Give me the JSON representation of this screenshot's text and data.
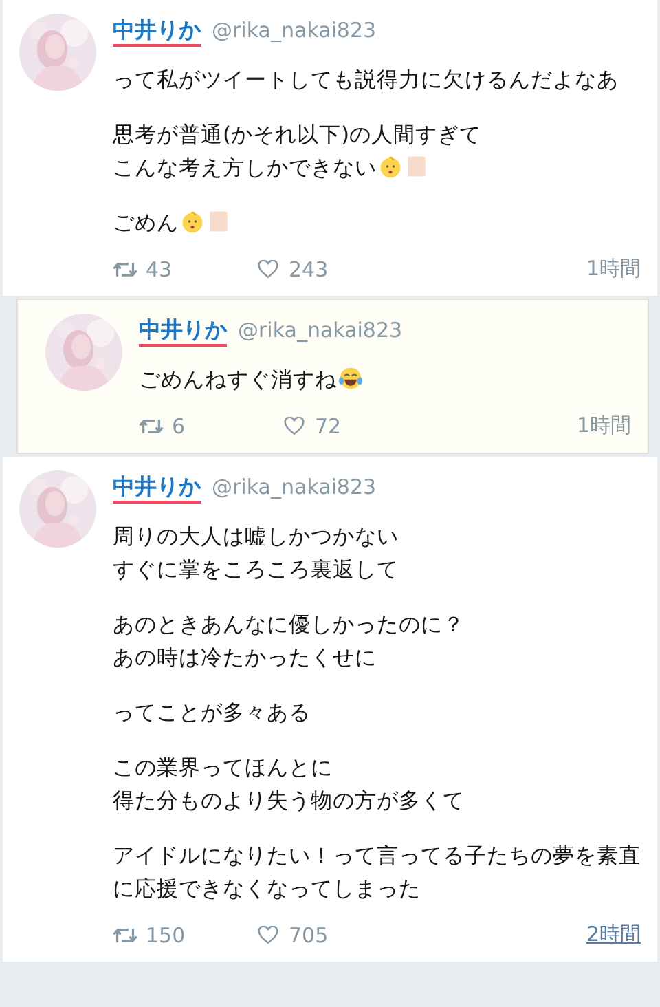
{
  "tweets": [
    {
      "highlighted": false,
      "name": "中井りか",
      "handle": "@rika_nakai823",
      "paragraphs": [
        {
          "lines": [
            {
              "kind": "plain",
              "text": "って私がツイートしても説得力に欠けるんだよなあ"
            }
          ]
        },
        {
          "lines": [
            {
              "kind": "plain",
              "text": "思考が普通(かそれ以下)の人間すぎて"
            },
            {
              "kind": "baby",
              "text": "こんな考え方しかできない"
            }
          ]
        },
        {
          "lines": [
            {
              "kind": "baby",
              "text": "ごめん"
            }
          ]
        }
      ],
      "retweets": "43",
      "likes": "243",
      "time": "1時間",
      "time_underlined": false
    },
    {
      "highlighted": true,
      "name": "中井りか",
      "handle": "@rika_nakai823",
      "paragraphs": [
        {
          "lines": [
            {
              "kind": "laugh",
              "text": "ごめんねすぐ消すね"
            }
          ]
        }
      ],
      "retweets": "6",
      "likes": "72",
      "time": "1時間",
      "time_underlined": false
    },
    {
      "highlighted": false,
      "name": "中井りか",
      "handle": "@rika_nakai823",
      "paragraphs": [
        {
          "lines": [
            {
              "kind": "plain",
              "text": "周りの大人は嘘しかつかない"
            },
            {
              "kind": "plain",
              "text": "すぐに掌をころころ裏返して"
            }
          ]
        },
        {
          "lines": [
            {
              "kind": "plain",
              "text": "あのときあんなに優しかったのに？"
            },
            {
              "kind": "plain",
              "text": "あの時は冷たかったくせに"
            }
          ]
        },
        {
          "lines": [
            {
              "kind": "plain",
              "text": "ってことが多々ある"
            }
          ]
        },
        {
          "lines": [
            {
              "kind": "plain",
              "text": "この業界ってほんとに"
            },
            {
              "kind": "plain",
              "text": "得た分ものより失う物の方が多くて"
            }
          ]
        },
        {
          "lines": [
            {
              "kind": "plain",
              "text": "アイドルになりたい！って言ってる子たちの夢を素直に応援できなくなってしまった"
            }
          ]
        }
      ],
      "retweets": "150",
      "likes": "705",
      "time": "2時間",
      "time_underlined": true
    }
  ]
}
